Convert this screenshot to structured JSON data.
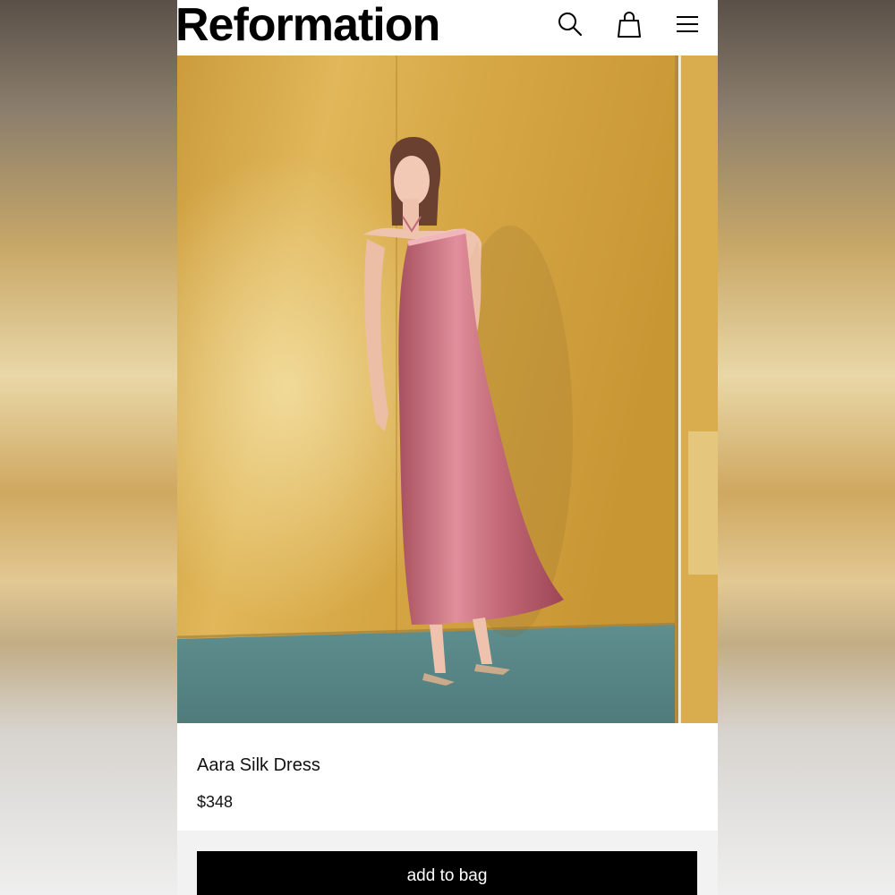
{
  "header": {
    "logo": "Reformation",
    "icons": [
      "search-icon",
      "bag-icon",
      "menu-icon"
    ]
  },
  "product": {
    "name": "Aara Silk Dress",
    "price": "$348",
    "image_alt": "Model wearing pink silk halter maxi dress against a wooden wall"
  },
  "actions": {
    "add_to_bag": "add to bag"
  },
  "colors": {
    "brand_text": "#000000",
    "button_bg": "#000000",
    "button_text": "#ffffff",
    "dress": "#c46a78",
    "wall": "#d6a541",
    "floor": "#5f8d8c"
  }
}
